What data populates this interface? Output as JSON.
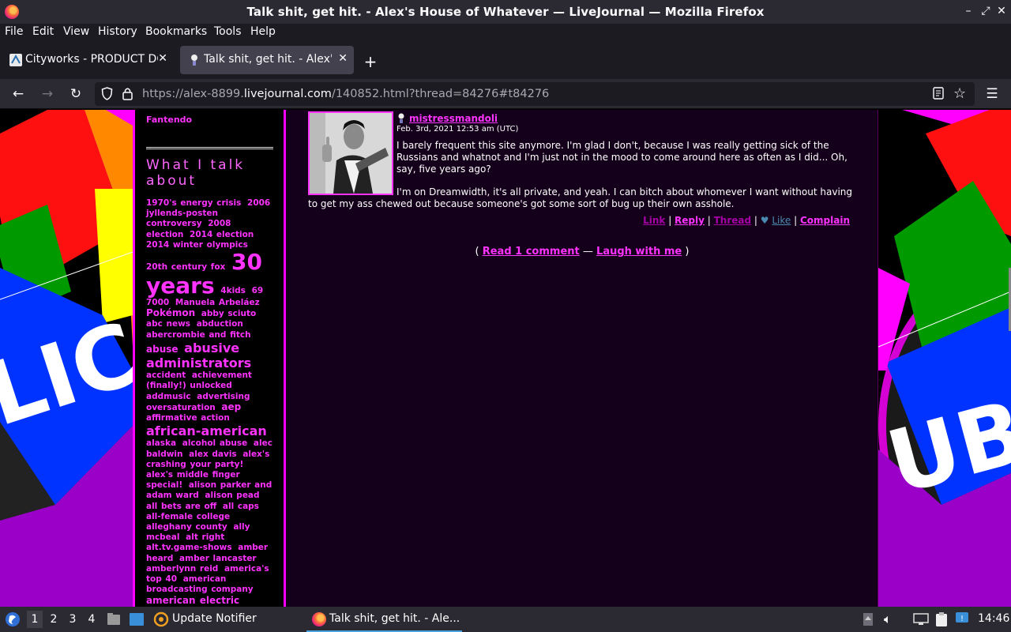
{
  "window": {
    "title": "Talk shit, get hit. - Alex's House of Whatever — LiveJournal — Mozilla Firefox"
  },
  "menu": [
    "File",
    "Edit",
    "View",
    "History",
    "Bookmarks",
    "Tools",
    "Help"
  ],
  "tabs": [
    {
      "label": "Cityworks - PRODUCT DO",
      "active": false
    },
    {
      "label": "Talk shit, get hit. - Alex's",
      "active": true
    }
  ],
  "url": {
    "prefix": "https://alex-8899.",
    "domain": "livejournal.com",
    "path": "/140852.html?thread=84276#t84276"
  },
  "sidebar": {
    "top_link": "Fantendo",
    "heading": "What I talk about",
    "tags": [
      {
        "t": "1970's energy crisis",
        "s": 1
      },
      {
        "t": "2006 jyllends-posten controversy",
        "s": 1
      },
      {
        "t": "2008 election",
        "s": 1
      },
      {
        "t": "2014 election",
        "s": 1
      },
      {
        "t": "2014 winter olympics",
        "s": 1
      },
      {
        "t": "20th century fox",
        "s": 1
      },
      {
        "t": "30 years",
        "s": 4
      },
      {
        "t": "4kids",
        "s": 1
      },
      {
        "t": "69",
        "s": 1
      },
      {
        "t": "7000",
        "s": 1
      },
      {
        "t": "Manuela Arbeláez",
        "s": 1
      },
      {
        "t": "Pokémon",
        "s": 2
      },
      {
        "t": "abby sciuto",
        "s": 1
      },
      {
        "t": "abc news",
        "s": 1
      },
      {
        "t": "abduction",
        "s": 1
      },
      {
        "t": "abercrombie and fitch",
        "s": 1
      },
      {
        "t": "abuse",
        "s": 2
      },
      {
        "t": "abusive administrators",
        "s": 3
      },
      {
        "t": "accident",
        "s": 1
      },
      {
        "t": "achievement (finally!) unlocked",
        "s": 1
      },
      {
        "t": "addmusic",
        "s": 1
      },
      {
        "t": "advertising oversaturation",
        "s": 1
      },
      {
        "t": "aep",
        "s": 2
      },
      {
        "t": "affirmative action",
        "s": 1
      },
      {
        "t": "african-american",
        "s": 3
      },
      {
        "t": "alaska",
        "s": 1
      },
      {
        "t": "alcohol abuse",
        "s": 1
      },
      {
        "t": "alec baldwin",
        "s": 1
      },
      {
        "t": "alex davis",
        "s": 1
      },
      {
        "t": "alex's crashing your party!",
        "s": 1
      },
      {
        "t": "alex's middle finger special!",
        "s": 1
      },
      {
        "t": "alison parker and adam ward",
        "s": 1
      },
      {
        "t": "alison pead",
        "s": 1
      },
      {
        "t": "all bets are off",
        "s": 1
      },
      {
        "t": "all caps",
        "s": 1
      },
      {
        "t": "all-female college",
        "s": 1
      },
      {
        "t": "alleghany county",
        "s": 1
      },
      {
        "t": "ally mcbeal",
        "s": 1
      },
      {
        "t": "alt right",
        "s": 1
      },
      {
        "t": "alt.tv.game-shows",
        "s": 1
      },
      {
        "t": "amber heard",
        "s": 1
      },
      {
        "t": "amber lancaster",
        "s": 1
      },
      {
        "t": "amberlynn reid",
        "s": 1
      },
      {
        "t": "america's top 40",
        "s": 1
      },
      {
        "t": "american broadcasting company",
        "s": 1
      },
      {
        "t": "american electric",
        "s": 2
      }
    ]
  },
  "comment": {
    "author": "mistressmandoli",
    "date": "Feb. 3rd, 2021 12:53 am (UTC)",
    "para1": "I barely frequent this site anymore. I'm glad I don't, because I was really getting sick of the Russians and whatnot and I'm just not in the mood to come around here as often as I did... Oh, say, five years ago?",
    "para2": "I'm on Dreamwidth, it's all private, and yeah. I can bitch about whomever I want without having to get my ass chewed out because someone's got some sort of bug up their own asshole.",
    "actions": {
      "link": "Link",
      "reply": "Reply",
      "thread": "Thread",
      "like": "Like",
      "complain": "Complain"
    }
  },
  "read_comments": {
    "read": "Read 1 comment",
    "laugh": "Laugh with me",
    "open": "(",
    "sep": "—",
    "close": ")"
  },
  "taskbar": {
    "workspaces": [
      "1",
      "2",
      "3",
      "4"
    ],
    "update_notifier": "Update Notifier",
    "active_window": "Talk shit, get hit. - Ale...",
    "clock": "14:46"
  }
}
